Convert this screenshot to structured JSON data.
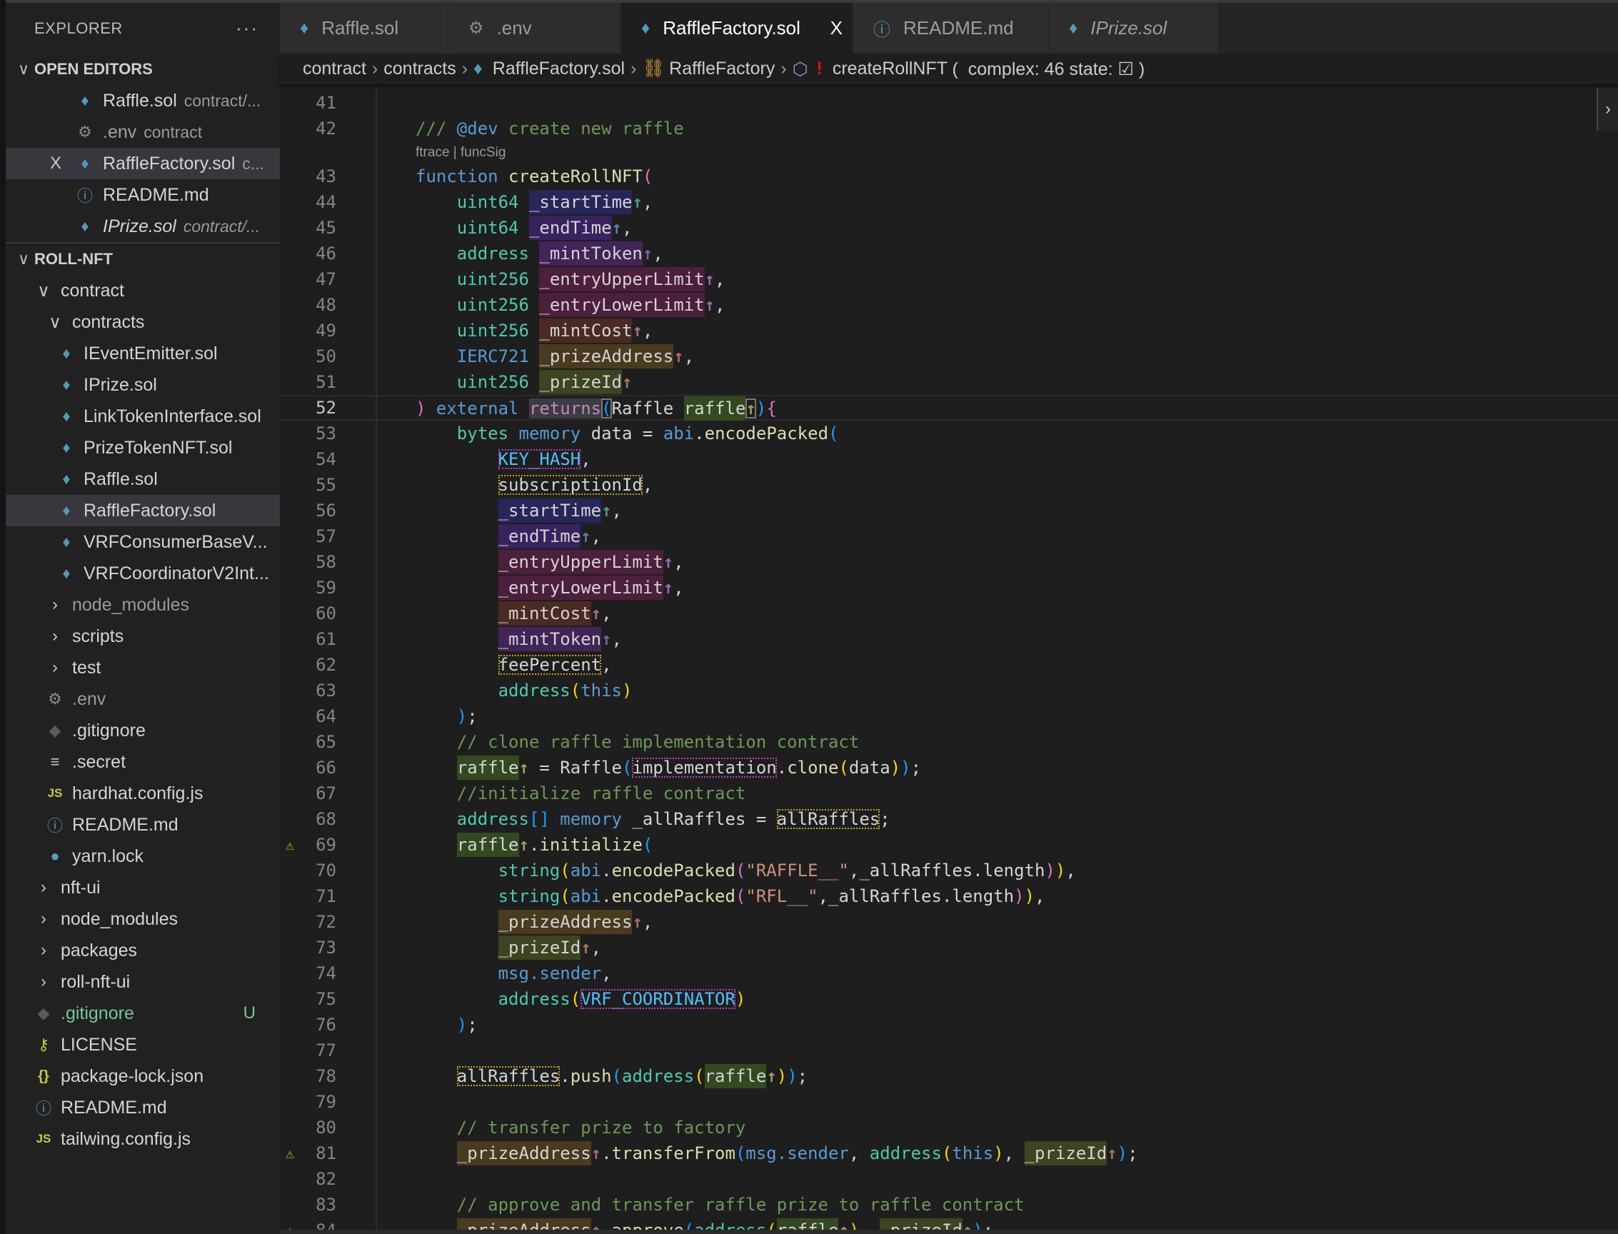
{
  "sidebar": {
    "title": "EXPLORER",
    "more": "···",
    "open_editors": {
      "title": "OPEN EDITORS",
      "items": [
        {
          "label": "Raffle.sol",
          "desc": "contract/...",
          "icon": "ethereum-icon"
        },
        {
          "label": ".env",
          "desc": "contract",
          "icon": "gear-icon",
          "dim": true
        },
        {
          "label": "RaffleFactory.sol",
          "desc": "c...",
          "icon": "ethereum-icon",
          "selected": true,
          "close": "X"
        },
        {
          "label": "README.md",
          "icon": "info-icon"
        },
        {
          "label": "IPrize.sol",
          "desc": "contract/...",
          "icon": "ethereum-icon",
          "italic": true
        }
      ]
    },
    "workspace": {
      "title": "ROLL-NFT",
      "tree": [
        {
          "label": "contract",
          "folder": true,
          "open": true,
          "children": [
            {
              "label": "contracts",
              "folder": true,
              "open": true,
              "children": [
                {
                  "label": "IEventEmitter.sol",
                  "icon": "ethereum-icon"
                },
                {
                  "label": "IPrize.sol",
                  "icon": "ethereum-icon"
                },
                {
                  "label": "LinkTokenInterface.sol",
                  "icon": "ethereum-icon"
                },
                {
                  "label": "PrizeTokenNFT.sol",
                  "icon": "ethereum-icon"
                },
                {
                  "label": "Raffle.sol",
                  "icon": "ethereum-icon"
                },
                {
                  "label": "RaffleFactory.sol",
                  "icon": "ethereum-icon",
                  "selected": true
                },
                {
                  "label": "VRFConsumerBaseV...",
                  "icon": "ethereum-icon"
                },
                {
                  "label": "VRFCoordinatorV2Int...",
                  "icon": "ethereum-icon"
                }
              ]
            },
            {
              "label": "node_modules",
              "folder": true,
              "dim": true
            },
            {
              "label": "scripts",
              "folder": true
            },
            {
              "label": "test",
              "folder": true
            },
            {
              "label": ".env",
              "icon": "gear-icon",
              "dim": true
            },
            {
              "label": ".gitignore",
              "icon": "git-icon"
            },
            {
              "label": ".secret",
              "icon": "lines-icon"
            },
            {
              "label": "hardhat.config.js",
              "icon": "js-icon"
            },
            {
              "label": "README.md",
              "icon": "info-icon"
            },
            {
              "label": "yarn.lock",
              "icon": "yarn-icon"
            }
          ]
        },
        {
          "label": "nft-ui",
          "folder": true
        },
        {
          "label": "node_modules",
          "folder": true
        },
        {
          "label": "packages",
          "folder": true
        },
        {
          "label": "roll-nft-ui",
          "folder": true
        },
        {
          "label": ".gitignore",
          "icon": "git-icon",
          "git": true,
          "badge": "U"
        },
        {
          "label": "LICENSE",
          "icon": "license-icon"
        },
        {
          "label": "package-lock.json",
          "icon": "json-icon"
        },
        {
          "label": "README.md",
          "icon": "info-icon"
        },
        {
          "label": "tailwing.config.js",
          "icon": "js-icon"
        }
      ]
    }
  },
  "tabs": [
    {
      "label": "Raffle.sol",
      "icon": "ethereum-icon"
    },
    {
      "label": ".env",
      "icon": "gear-icon"
    },
    {
      "label": "RaffleFactory.sol",
      "icon": "ethereum-icon",
      "active": true,
      "close": "X"
    },
    {
      "label": "README.md",
      "icon": "info-icon"
    },
    {
      "label": "IPrize.sol",
      "icon": "ethereum-icon",
      "italic": true
    }
  ],
  "breadcrumb": {
    "parts": [
      "contract",
      "contracts",
      "RaffleFactory.sol",
      "RaffleFactory"
    ],
    "symbol": "createRollNFT",
    "bang": "!",
    "detail": "(  complex: 46 state: ☑ )",
    "separator": "›"
  },
  "editor": {
    "codelens": "ftrace | funcSig",
    "codelens_after_line": 42,
    "current_line": 52,
    "warning_lines": [
      69,
      81,
      84
    ],
    "first_line": 41,
    "lines": [
      [],
      [
        [
          "/// ",
          "c"
        ],
        [
          "@dev",
          "k"
        ],
        [
          " create new raffle",
          "c"
        ]
      ],
      [
        [
          "function ",
          "k"
        ],
        [
          "createRollNFT",
          "f"
        ],
        [
          "(",
          "b1"
        ]
      ],
      [
        [
          "    ",
          ""
        ],
        [
          "uint64 ",
          "t"
        ],
        [
          "_startTime",
          "p h1"
        ],
        [
          "↑",
          "a1"
        ],
        [
          ",",
          "p"
        ]
      ],
      [
        [
          "    ",
          ""
        ],
        [
          "uint64 ",
          "t"
        ],
        [
          "_endTime",
          "p h2"
        ],
        [
          "↑",
          "a2"
        ],
        [
          ",",
          "p"
        ]
      ],
      [
        [
          "    ",
          ""
        ],
        [
          "address ",
          "t"
        ],
        [
          "_mintToken",
          "p h3"
        ],
        [
          "↑",
          "a3"
        ],
        [
          ",",
          "p"
        ]
      ],
      [
        [
          "    ",
          ""
        ],
        [
          "uint256 ",
          "t"
        ],
        [
          "_entryUpperLimit",
          "p h4"
        ],
        [
          "↑",
          "a4"
        ],
        [
          ",",
          "p"
        ]
      ],
      [
        [
          "    ",
          ""
        ],
        [
          "uint256 ",
          "t"
        ],
        [
          "_entryLowerLimit",
          "p h4"
        ],
        [
          "↑",
          "a4"
        ],
        [
          ",",
          "p"
        ]
      ],
      [
        [
          "    ",
          ""
        ],
        [
          "uint256 ",
          "t"
        ],
        [
          "_mintCost",
          "p h5"
        ],
        [
          "↑",
          "a5"
        ],
        [
          ",",
          "p"
        ]
      ],
      [
        [
          "    ",
          ""
        ],
        [
          "IERC721 ",
          "k"
        ],
        [
          "_prizeAddress",
          "p h6"
        ],
        [
          "↑",
          "a6"
        ],
        [
          ",",
          "p"
        ]
      ],
      [
        [
          "    ",
          ""
        ],
        [
          "uint256 ",
          "t"
        ],
        [
          "_prizeId",
          "p h7"
        ],
        [
          "↑",
          "a7"
        ]
      ],
      [
        [
          ")",
          "b1"
        ],
        [
          " external ",
          "k"
        ],
        [
          "returns",
          "rt"
        ],
        [
          "(",
          "b2 bx"
        ],
        [
          "Raffle ",
          "p"
        ],
        [
          "raffle",
          "p h8"
        ],
        [
          "↑",
          "a8 bx"
        ],
        [
          ")",
          "b2"
        ],
        [
          "{",
          "b1"
        ]
      ],
      [
        [
          "    ",
          ""
        ],
        [
          "bytes ",
          "t"
        ],
        [
          "memory ",
          "k"
        ],
        [
          "data = ",
          "p"
        ],
        [
          "abi",
          "k"
        ],
        [
          ".",
          "p"
        ],
        [
          "encodePacked",
          "f"
        ],
        [
          "(",
          "b2"
        ]
      ],
      [
        [
          "        ",
          ""
        ],
        [
          "KEY_HASH",
          "cn dm"
        ],
        [
          ",",
          "p"
        ]
      ],
      [
        [
          "        ",
          ""
        ],
        [
          "subscriptionId",
          "p dy"
        ],
        [
          ",",
          "p"
        ]
      ],
      [
        [
          "        ",
          ""
        ],
        [
          "_startTime",
          "p h1"
        ],
        [
          "↑",
          "a1"
        ],
        [
          ",",
          "p"
        ]
      ],
      [
        [
          "        ",
          ""
        ],
        [
          "_endTime",
          "p h2"
        ],
        [
          "↑",
          "a2"
        ],
        [
          ",",
          "p"
        ]
      ],
      [
        [
          "        ",
          ""
        ],
        [
          "_entryUpperLimit",
          "p h4"
        ],
        [
          "↑",
          "a4"
        ],
        [
          ",",
          "p"
        ]
      ],
      [
        [
          "        ",
          ""
        ],
        [
          "_entryLowerLimit",
          "p h4"
        ],
        [
          "↑",
          "a4"
        ],
        [
          ",",
          "p"
        ]
      ],
      [
        [
          "        ",
          ""
        ],
        [
          "_mintCost",
          "p h5"
        ],
        [
          "↑",
          "a5"
        ],
        [
          ",",
          "p"
        ]
      ],
      [
        [
          "        ",
          ""
        ],
        [
          "_mintToken",
          "p h3"
        ],
        [
          "↑",
          "a3"
        ],
        [
          ",",
          "p"
        ]
      ],
      [
        [
          "        ",
          ""
        ],
        [
          "feePercent",
          "p dy"
        ],
        [
          ",",
          "p"
        ]
      ],
      [
        [
          "        ",
          ""
        ],
        [
          "address",
          "t"
        ],
        [
          "(",
          "b3"
        ],
        [
          "this",
          "k"
        ],
        [
          ")",
          "b3"
        ]
      ],
      [
        [
          "    ",
          ""
        ],
        [
          ")",
          "b2"
        ],
        [
          ";",
          "p"
        ]
      ],
      [
        [
          "    ",
          ""
        ],
        [
          "// clone raffle implementation contract",
          "c"
        ]
      ],
      [
        [
          "    ",
          ""
        ],
        [
          "raffle",
          "p h8"
        ],
        [
          "↑",
          "a8"
        ],
        [
          " = Raffle",
          "p"
        ],
        [
          "(",
          "b2"
        ],
        [
          "implementation",
          "p dm"
        ],
        [
          ".",
          "p"
        ],
        [
          "clone",
          "f"
        ],
        [
          "(",
          "b3"
        ],
        [
          "data",
          "p"
        ],
        [
          ")",
          "b3"
        ],
        [
          ")",
          "b2"
        ],
        [
          ";",
          "p"
        ]
      ],
      [
        [
          "    ",
          ""
        ],
        [
          "//initialize raffle contract",
          "c"
        ]
      ],
      [
        [
          "    ",
          ""
        ],
        [
          "address",
          "t"
        ],
        [
          "[]",
          "b2"
        ],
        [
          " memory ",
          "k"
        ],
        [
          "_allRaffles = ",
          "p"
        ],
        [
          "allRaffles",
          "p dy"
        ],
        [
          ";",
          "p"
        ]
      ],
      [
        [
          "    ",
          ""
        ],
        [
          "raffle",
          "p h8"
        ],
        [
          "↑",
          "a8"
        ],
        [
          ".",
          "p"
        ],
        [
          "initialize",
          "f"
        ],
        [
          "(",
          "b2"
        ]
      ],
      [
        [
          "        ",
          ""
        ],
        [
          "string",
          "t"
        ],
        [
          "(",
          "b3"
        ],
        [
          "abi",
          "k"
        ],
        [
          ".",
          "p"
        ],
        [
          "encodePacked",
          "f"
        ],
        [
          "(",
          "b1"
        ],
        [
          "\"RAFFLE__\"",
          "s"
        ],
        [
          ",_allRaffles.length",
          "p"
        ],
        [
          ")",
          "b1"
        ],
        [
          ")",
          "b3"
        ],
        [
          ",",
          "p"
        ]
      ],
      [
        [
          "        ",
          ""
        ],
        [
          "string",
          "t"
        ],
        [
          "(",
          "b3"
        ],
        [
          "abi",
          "k"
        ],
        [
          ".",
          "p"
        ],
        [
          "encodePacked",
          "f"
        ],
        [
          "(",
          "b1"
        ],
        [
          "\"RFL__\"",
          "s"
        ],
        [
          ",_allRaffles.length",
          "p"
        ],
        [
          ")",
          "b1"
        ],
        [
          ")",
          "b3"
        ],
        [
          ",",
          "p"
        ]
      ],
      [
        [
          "        ",
          ""
        ],
        [
          "_prizeAddress",
          "p h6"
        ],
        [
          "↑",
          "a6"
        ],
        [
          ",",
          "p"
        ]
      ],
      [
        [
          "        ",
          ""
        ],
        [
          "_prizeId",
          "p h7"
        ],
        [
          "↑",
          "a7"
        ],
        [
          ",",
          "p"
        ]
      ],
      [
        [
          "        ",
          ""
        ],
        [
          "msg.sender",
          "k"
        ],
        [
          ",",
          "p"
        ]
      ],
      [
        [
          "        ",
          ""
        ],
        [
          "address",
          "t"
        ],
        [
          "(",
          "b3"
        ],
        [
          "VRF_COORDINATOR",
          "cn dm"
        ],
        [
          ")",
          "b3"
        ]
      ],
      [
        [
          "    ",
          ""
        ],
        [
          ")",
          "b2"
        ],
        [
          ";",
          "p"
        ]
      ],
      [],
      [
        [
          "    ",
          ""
        ],
        [
          "allRaffles",
          "p dy"
        ],
        [
          ".",
          "p"
        ],
        [
          "push",
          "f"
        ],
        [
          "(",
          "b2"
        ],
        [
          "address",
          "t"
        ],
        [
          "(",
          "b3"
        ],
        [
          "raffle",
          "p h8"
        ],
        [
          "↑",
          "a8"
        ],
        [
          ")",
          "b3"
        ],
        [
          ")",
          "b2"
        ],
        [
          ";",
          "p"
        ]
      ],
      [],
      [
        [
          "    ",
          ""
        ],
        [
          "// transfer prize to factory",
          "c"
        ]
      ],
      [
        [
          "    ",
          ""
        ],
        [
          "_prizeAddress",
          "p h6"
        ],
        [
          "↑",
          "a6"
        ],
        [
          ".",
          "p"
        ],
        [
          "transferFrom",
          "f"
        ],
        [
          "(",
          "b2"
        ],
        [
          "msg.sender",
          "k"
        ],
        [
          ", ",
          "p"
        ],
        [
          "address",
          "t"
        ],
        [
          "(",
          "b3"
        ],
        [
          "this",
          "k"
        ],
        [
          ")",
          "b3"
        ],
        [
          ", ",
          "p"
        ],
        [
          "_prizeId",
          "p h7"
        ],
        [
          "↑",
          "a7"
        ],
        [
          ")",
          "b2"
        ],
        [
          ";",
          "p"
        ]
      ],
      [],
      [
        [
          "    ",
          ""
        ],
        [
          "// approve and transfer raffle prize to raffle contract",
          "c"
        ]
      ],
      [
        [
          "    ",
          ""
        ],
        [
          "_prizeAddress",
          "p h6"
        ],
        [
          "↑",
          "a6"
        ],
        [
          ".",
          "p"
        ],
        [
          "approve",
          "f"
        ],
        [
          "(",
          "b2"
        ],
        [
          "address",
          "t"
        ],
        [
          "(",
          "b3"
        ],
        [
          "raffle",
          "p h8"
        ],
        [
          "↑",
          "a8"
        ],
        [
          ")",
          "b3"
        ],
        [
          ", ",
          "p"
        ],
        [
          "_prizeId",
          "p h7"
        ],
        [
          "↑",
          "a7"
        ],
        [
          ")",
          "b2"
        ],
        [
          ";",
          "p"
        ]
      ]
    ]
  },
  "colors": {
    "accent": "#519aba",
    "warning": "#cca700",
    "git_untracked": "#73c991",
    "editor_bg": "#1e1e1e"
  }
}
